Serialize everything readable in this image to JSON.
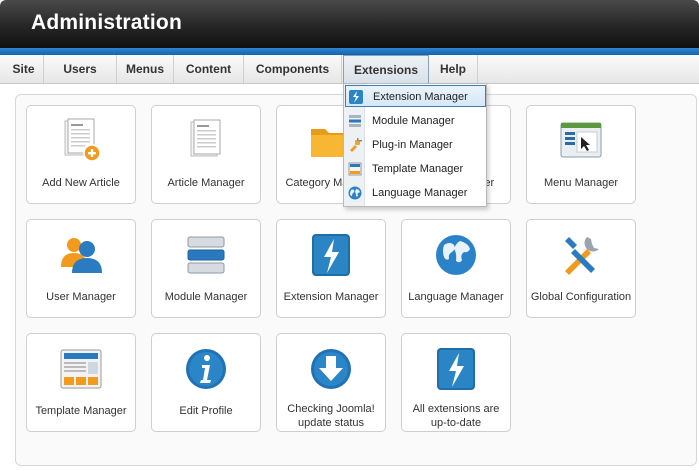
{
  "header": {
    "title": "Administration"
  },
  "menu": {
    "items": [
      {
        "label": "Site"
      },
      {
        "label": "Users"
      },
      {
        "label": "Menus"
      },
      {
        "label": "Content"
      },
      {
        "label": "Components"
      },
      {
        "label": "Extensions"
      },
      {
        "label": "Help"
      }
    ]
  },
  "dropdown": {
    "items": [
      {
        "label": "Extension Manager",
        "icon": "lightning-icon"
      },
      {
        "label": "Module Manager",
        "icon": "module-icon"
      },
      {
        "label": "Plug-in Manager",
        "icon": "plugin-icon"
      },
      {
        "label": "Template Manager",
        "icon": "template-icon"
      },
      {
        "label": "Language Manager",
        "icon": "globe-icon"
      }
    ]
  },
  "tiles": {
    "add_article": "Add New Article",
    "article_manager": "Article Manager",
    "category_manager": "Category Manager",
    "media_manager": "Media Manager",
    "menu_manager": "Menu Manager",
    "user_manager": "User Manager",
    "module_manager": "Module Manager",
    "extension_manager": "Extension Manager",
    "language_manager": "Language Manager",
    "global_config": "Global Configuration",
    "template_manager": "Template Manager",
    "edit_profile": "Edit Profile",
    "update_line1": "Checking Joomla!",
    "update_line2": "update status",
    "ext_line1": "All extensions are",
    "ext_line2": "up-to-date"
  },
  "colors": {
    "accent_blue": "#1463ad",
    "header_dark": "#262626",
    "highlight": "#3b7fae"
  }
}
